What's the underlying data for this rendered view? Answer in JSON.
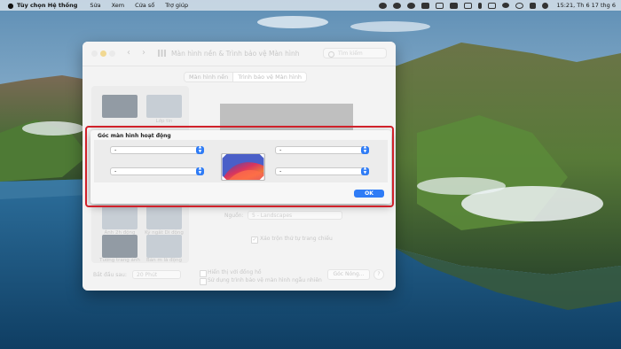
{
  "menubar": {
    "app_name": "Tùy chọn Hệ thống",
    "items": [
      "Sửa",
      "Xem",
      "Cửa sổ",
      "Trợ giúp"
    ],
    "clock": "15:21, Th 6 17 thg 6"
  },
  "window": {
    "title": "Màn hình nền & Trình bảo vệ Màn hình",
    "search_placeholder": "Tìm kiếm",
    "tabs": [
      "Màn hình nền",
      "Trình bảo vệ Màn hình"
    ],
    "selected_tab": "Trình bảo vệ Màn hình",
    "thumbnails": [
      "Lớp tin",
      "Ảnh 2h động",
      "Ký ngắt Di động",
      "Tường trang ảnh",
      "Bản m là động"
    ],
    "source_label": "Nguồn:",
    "source_value": "5 - Landscapes",
    "shuffle_label": "Xáo trộn thứ tự trang chiếu",
    "start_after_label": "Bắt đầu sau:",
    "start_after_value": "20 Phút",
    "show_clock_label": "Hiển thị với đồng hồ",
    "random_label": "Sử dụng trình bảo vệ màn hình ngẫu nhiên",
    "hot_corners_button": "Góc Nóng...",
    "help_button": "?"
  },
  "sheet": {
    "title": "Góc màn hình hoạt động",
    "corners": {
      "top_left": "-",
      "top_right": "-",
      "bottom_left": "-",
      "bottom_right": "-"
    },
    "ok_label": "OK"
  },
  "colors": {
    "accent": "#2f7cf6",
    "highlight_border": "#d0212a"
  }
}
